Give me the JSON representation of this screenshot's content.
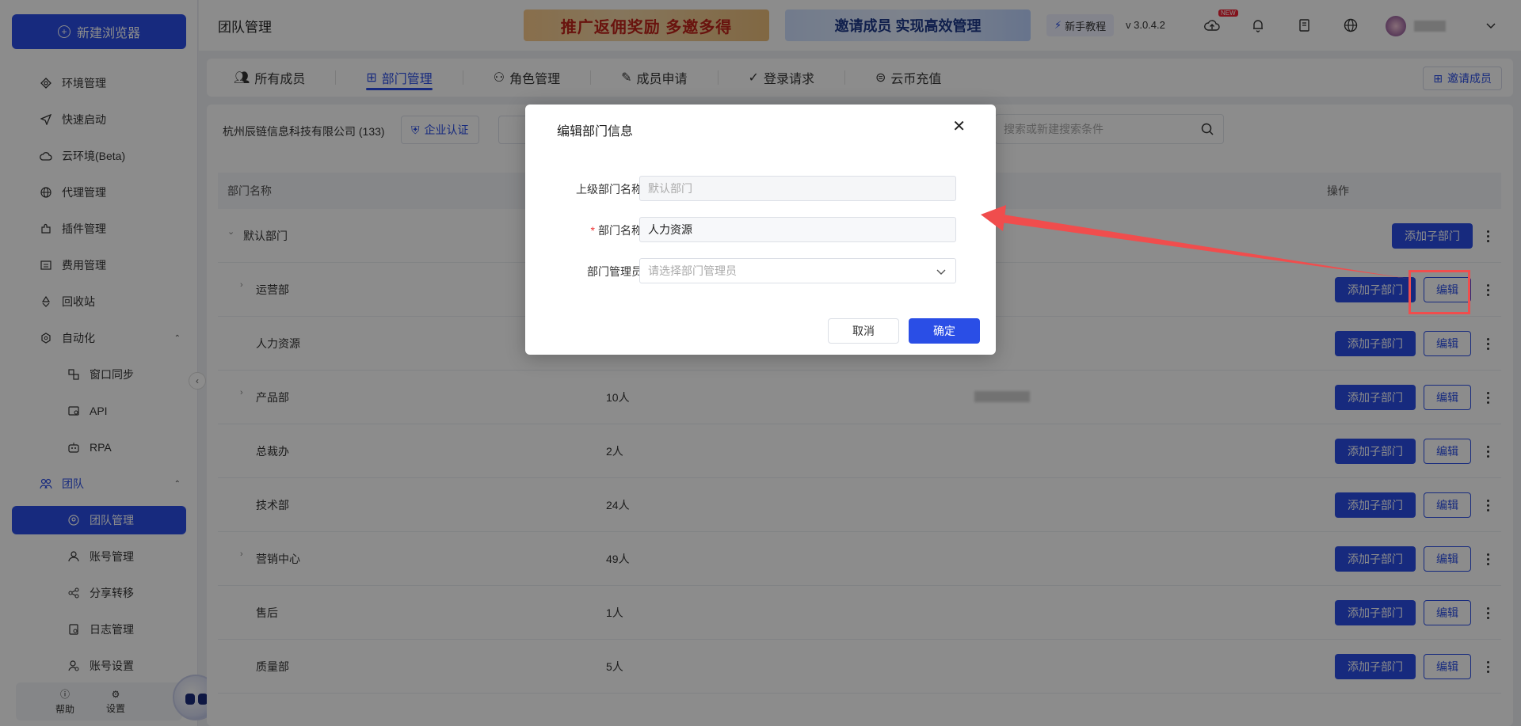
{
  "sidebar": {
    "new_browser_label": "新建浏览器",
    "items": [
      {
        "label": "环境管理",
        "icon": "environment-icon"
      },
      {
        "label": "快速启动",
        "icon": "send-icon"
      },
      {
        "label": "云环境(Beta)",
        "icon": "cloud-icon"
      },
      {
        "label": "代理管理",
        "icon": "globe-icon"
      },
      {
        "label": "插件管理",
        "icon": "plugin-icon"
      },
      {
        "label": "费用管理",
        "icon": "bill-icon"
      },
      {
        "label": "回收站",
        "icon": "recycle-icon"
      },
      {
        "label": "自动化",
        "icon": "automation-icon"
      },
      {
        "label": "窗口同步",
        "icon": "window-sync-icon"
      },
      {
        "label": "API",
        "icon": "api-icon"
      },
      {
        "label": "RPA",
        "icon": "robot-icon"
      },
      {
        "label": "团队",
        "icon": "team-icon"
      },
      {
        "label": "团队管理",
        "icon": "team-manage-icon"
      },
      {
        "label": "账号管理",
        "icon": "user-icon"
      },
      {
        "label": "分享转移",
        "icon": "share-icon"
      },
      {
        "label": "日志管理",
        "icon": "log-icon"
      },
      {
        "label": "账号设置",
        "icon": "user-settings-icon"
      }
    ],
    "footer": {
      "help_label": "帮助",
      "settings_label": "设置"
    }
  },
  "header": {
    "title": "团队管理",
    "banner1_text": "推广返佣奖励 多邀多得",
    "banner2_text": "邀请成员 实现高效管理",
    "tutorial_label": "新手教程",
    "version": "v 3.0.4.2",
    "new_tag": "NEW"
  },
  "tabs": [
    {
      "label": "所有成员"
    },
    {
      "label": "部门管理"
    },
    {
      "label": "角色管理"
    },
    {
      "label": "成员申请"
    },
    {
      "label": "登录请求"
    },
    {
      "label": "云币充值"
    }
  ],
  "invite_label": "邀请成员",
  "toolbar": {
    "company": "杭州辰链信息科技有限公司 (133)",
    "cert_label": "企业认证",
    "search_placeholder": "搜索或新建搜索条件"
  },
  "table": {
    "col_name": "部门名称",
    "col_actions": "操作",
    "add_child_label": "添加子部门",
    "edit_label": "编辑",
    "rows": [
      {
        "name": "默认部门",
        "count": ""
      },
      {
        "name": "运营部",
        "count": ""
      },
      {
        "name": "人力资源",
        "count": ""
      },
      {
        "name": "产品部",
        "count": "10人"
      },
      {
        "name": "总裁办",
        "count": "2人"
      },
      {
        "name": "技术部",
        "count": "24人"
      },
      {
        "name": "营销中心",
        "count": "49人"
      },
      {
        "name": "售后",
        "count": "1人"
      },
      {
        "name": "质量部",
        "count": "5人"
      }
    ]
  },
  "modal": {
    "title": "编辑部门信息",
    "parent_label": "上级部门名称",
    "parent_value": "默认部门",
    "name_label": "部门名称",
    "name_value": "人力资源",
    "manager_label": "部门管理员",
    "manager_placeholder": "请选择部门管理员",
    "cancel_label": "取消",
    "ok_label": "确定"
  },
  "colors": {
    "accent": "#2a4ee6",
    "annotation": "#f04d4d"
  }
}
